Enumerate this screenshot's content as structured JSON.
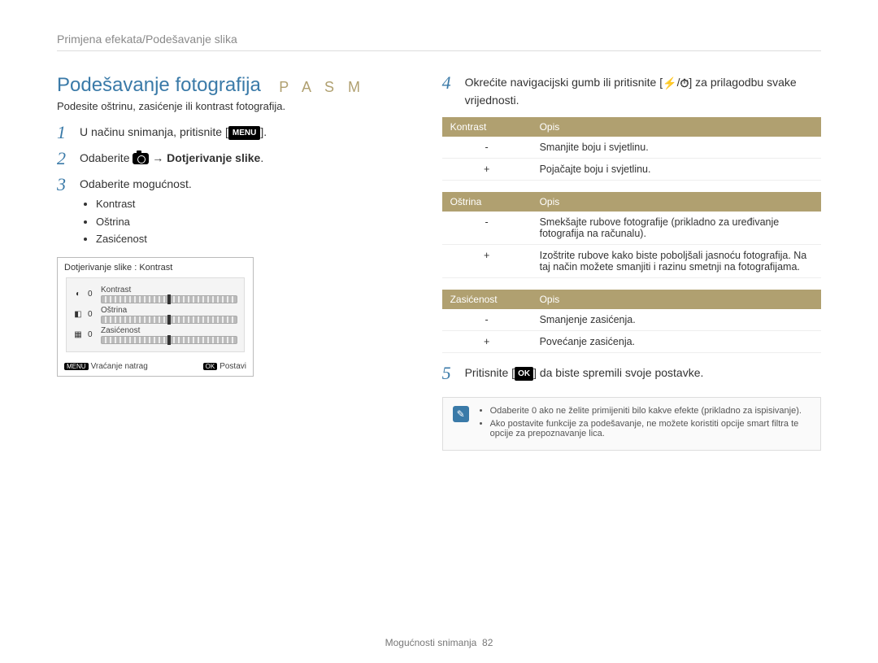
{
  "breadcrumb": "Primjena efekata/Podešavanje slika",
  "title": "Podešavanje fotografija",
  "modes": "P A S M",
  "subtitle": "Podesite oštrinu, zasićenje ili kontrast fotografija.",
  "steps": {
    "s1_a": "U načinu snimanja, pritisnite [",
    "s1_menu": "MENU",
    "s1_b": "].",
    "s2_a": "Odaberite ",
    "s2_arrow": " → ",
    "s2_bold": "Dotjerivanje slike",
    "s2_b": ".",
    "s3": "Odaberite mogućnost.",
    "s3_items": [
      "Kontrast",
      "Oštrina",
      "Zasićenost"
    ],
    "s4_a": "Okrećite navigacijski gumb ili pritisnite [",
    "s4_mid": "/",
    "s4_b": "] za prilagodbu svake vrijednosti.",
    "s5_a": "Pritisnite [",
    "s5_ok": "OK",
    "s5_b": "] da biste spremili svoje postavke."
  },
  "screen": {
    "title": "Dotjerivanje slike : Kontrast",
    "rows": [
      {
        "icon": "◐",
        "val": "0",
        "label": "Kontrast"
      },
      {
        "icon": "◧",
        "val": "0",
        "label": "Oštrina"
      },
      {
        "icon": "▦",
        "val": "0",
        "label": "Zasićenost"
      }
    ],
    "footer_left_pill": "MENU",
    "footer_left": "Vraćanje natrag",
    "footer_right_pill": "OK",
    "footer_right": "Postavi"
  },
  "tables": {
    "kontrast": {
      "head": [
        "Kontrast",
        "Opis"
      ],
      "rows": [
        [
          "-",
          "Smanjite boju i svjetlinu."
        ],
        [
          "+",
          "Pojačajte boju i svjetlinu."
        ]
      ]
    },
    "ostrina": {
      "head": [
        "Oštrina",
        "Opis"
      ],
      "rows": [
        [
          "-",
          "Smekšajte rubove fotografije (prikladno za uređivanje fotografija na računalu)."
        ],
        [
          "+",
          "Izoštrite rubove kako biste poboljšali jasnoću fotografija. Na taj način možete smanjiti i razinu smetnji na fotografijama."
        ]
      ]
    },
    "zasicenost": {
      "head": [
        "Zasićenost",
        "Opis"
      ],
      "rows": [
        [
          "-",
          "Smanjenje zasićenja."
        ],
        [
          "+",
          "Povećanje zasićenja."
        ]
      ]
    }
  },
  "note": [
    "Odaberite 0 ako ne želite primijeniti bilo kakve efekte (prikladno za ispisivanje).",
    "Ako postavite funkcije za podešavanje, ne možete koristiti opcije smart filtra te opcije za prepoznavanje lica."
  ],
  "footer_text": "Mogućnosti snimanja",
  "footer_page": "82"
}
